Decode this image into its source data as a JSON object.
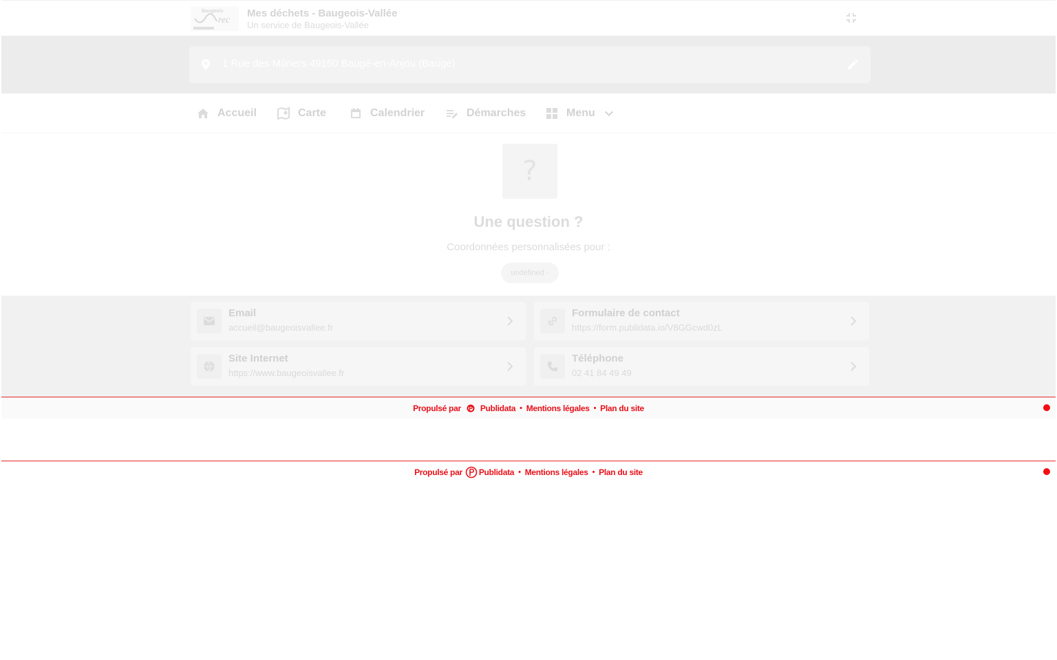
{
  "header": {
    "title": "Mes déchets - Baugeois-Vallée",
    "subtitle": "Un service de Baugeois-Vallée"
  },
  "address": {
    "value": "1 Rue des Mûriers 49150 Baugé-en-Anjou (Baugé)"
  },
  "nav": {
    "items": [
      {
        "label": "Accueil",
        "icon": "home-icon"
      },
      {
        "label": "Carte",
        "icon": "map-icon"
      },
      {
        "label": "Calendrier",
        "icon": "calendar-icon"
      },
      {
        "label": "Démarches",
        "icon": "edit-note-icon"
      },
      {
        "label": "Menu",
        "icon": "grid-icon"
      }
    ]
  },
  "question": {
    "icon_glyph": "?",
    "title": "Une question ?",
    "subtitle": "Coordonnées personnalisées pour :",
    "chip": "undefined -"
  },
  "contacts": [
    {
      "title": "Email",
      "value": "accueil@baugeoisvallee.fr",
      "icon": "mail-icon"
    },
    {
      "title": "Formulaire de contact",
      "value": "https://form.publidata.io/V8GGcwd0zL",
      "icon": "link-icon"
    },
    {
      "title": "Site Internet",
      "value": "https://www.baugeoisvallee.fr",
      "icon": "globe-icon"
    },
    {
      "title": "Téléphone",
      "value": "02 41 84 49 49",
      "icon": "phone-icon"
    }
  ],
  "footer": {
    "powered_by": "Propulsé par",
    "brand": "Publidata",
    "legal": "Mentions légales",
    "sitemap": "Plan du site",
    "separator": "•"
  },
  "colors": {
    "footer_red": "#e8111a",
    "overlay_gray": "#ececec"
  }
}
